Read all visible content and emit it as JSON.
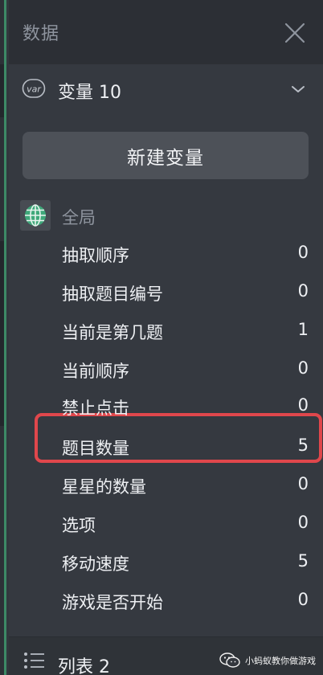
{
  "header": {
    "title": "数据"
  },
  "variables": {
    "icon_text": "var",
    "label": "变量 10",
    "new_button_label": "新建变量",
    "group_label": "全局",
    "items": [
      {
        "name": "抽取顺序",
        "value": "0"
      },
      {
        "name": "抽取题目编号",
        "value": "0"
      },
      {
        "name": "当前是第几题",
        "value": "1"
      },
      {
        "name": "当前顺序",
        "value": "0"
      },
      {
        "name": "禁止点击",
        "value": "0"
      },
      {
        "name": "题目数量",
        "value": "5"
      },
      {
        "name": "星星的数量",
        "value": "0"
      },
      {
        "name": "选项",
        "value": "0"
      },
      {
        "name": "移动速度",
        "value": "5"
      },
      {
        "name": "游戏是否开始",
        "value": "0"
      }
    ]
  },
  "lists": {
    "label": "列表 2"
  },
  "watermark": {
    "text": "小蚂蚁教你做游戏"
  },
  "colors": {
    "accent_green": "#3d8a66",
    "highlight_red": "#e0474c",
    "globe_green": "#3fa87a"
  }
}
